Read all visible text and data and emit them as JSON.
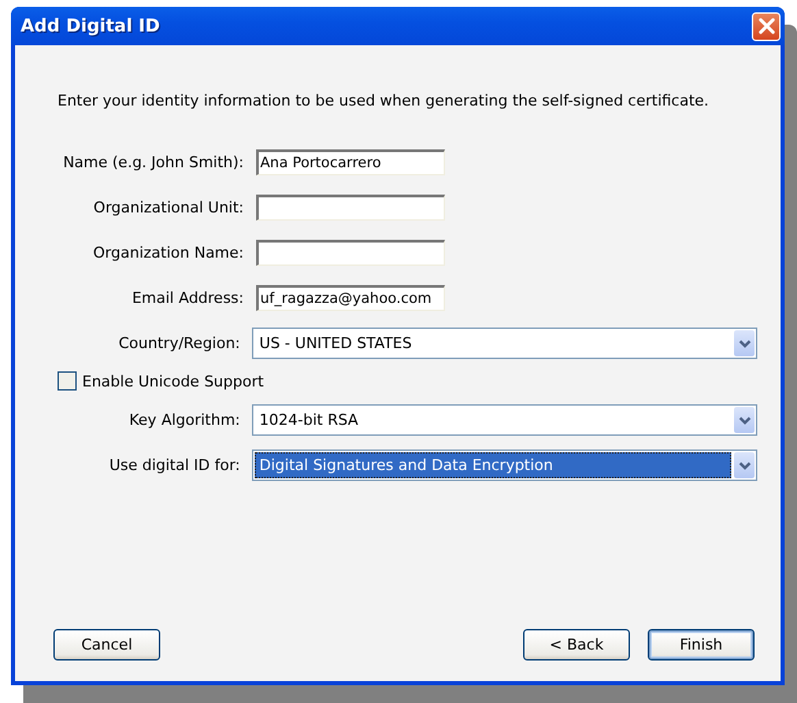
{
  "window": {
    "title": "Add Digital ID"
  },
  "intro": "Enter your identity information to be used when generating the self-signed certificate.",
  "fields": [
    {
      "kind": "text",
      "label": "Name (e.g. John Smith):",
      "value": "Ana Portocarrero"
    },
    {
      "kind": "text",
      "label": "Organizational Unit:"
    },
    {
      "kind": "text",
      "label": "Organization Name:"
    },
    {
      "kind": "text",
      "label": "Email Address:",
      "value": "uf_ragazza@yahoo.com"
    },
    {
      "kind": "select",
      "label": "Country/Region:",
      "value": "US - UNITED STATES",
      "focused": false
    }
  ],
  "unicode": {
    "label": "Enable Unicode Support",
    "checked": false
  },
  "options": [
    {
      "kind": "select",
      "label": "Key Algorithm:",
      "value": "1024-bit RSA",
      "focused": false
    },
    {
      "kind": "select",
      "label": "Use digital ID for:",
      "value": "Digital Signatures and Data Encryption",
      "focused": true
    }
  ],
  "buttons": [
    {
      "label": "Cancel",
      "default": false
    },
    {
      "label": "< Back",
      "default": false
    },
    {
      "label": "Finish",
      "default": true
    }
  ]
}
